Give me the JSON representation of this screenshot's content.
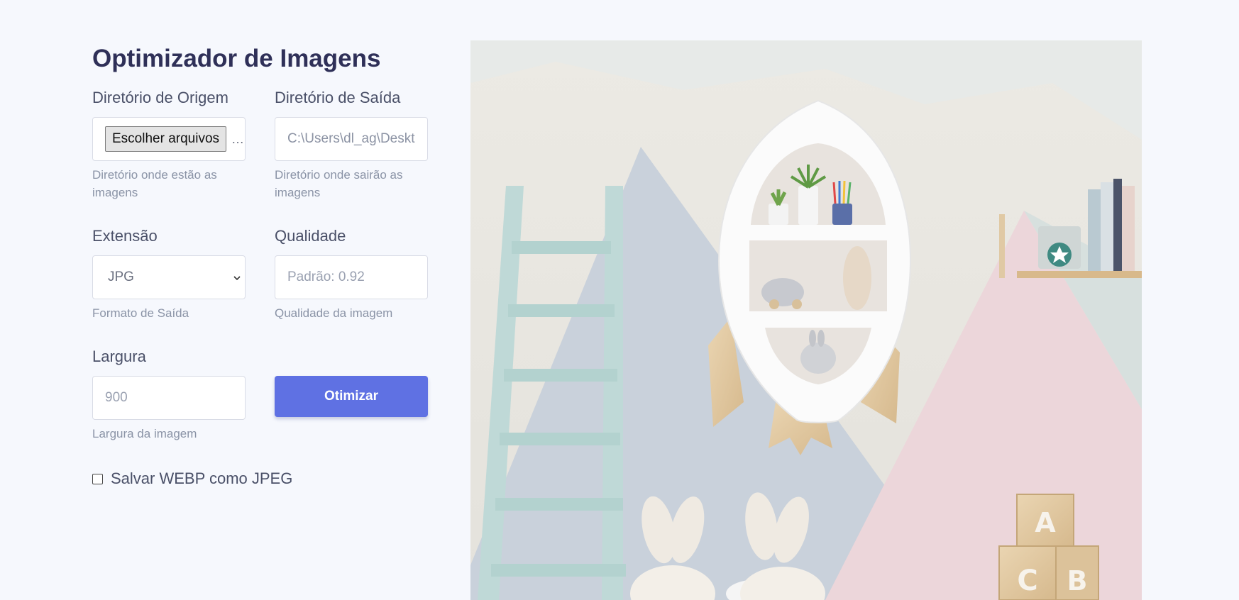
{
  "title": "Optimizador de Imagens",
  "source_dir": {
    "label": "Diretório de Origem",
    "button": "Escolher arquivos",
    "overflow": "…",
    "hint": "Diretório onde estão as imagens"
  },
  "output_dir": {
    "label": "Diretório de Saída",
    "value": "C:\\Users\\dl_ag\\Deskto",
    "hint": "Diretório onde sairão as imagens"
  },
  "extension": {
    "label": "Extensão",
    "selected": "JPG",
    "hint": "Formato de Saída"
  },
  "quality": {
    "label": "Qualidade",
    "placeholder": "Padrão: 0.92",
    "hint": "Qualidade da imagem"
  },
  "width": {
    "label": "Largura",
    "placeholder": "900",
    "hint": "Largura da imagem"
  },
  "optimize_button": "Otimizar",
  "webp_checkbox": {
    "label": "Salvar WEBP como JPEG",
    "checked": false
  },
  "preview_blocks": {
    "block_a": "A",
    "block_c": "C",
    "block_b": "B"
  },
  "colors": {
    "background": "#f6f8fd",
    "title": "#2f3058",
    "accent": "#5f71e3"
  }
}
